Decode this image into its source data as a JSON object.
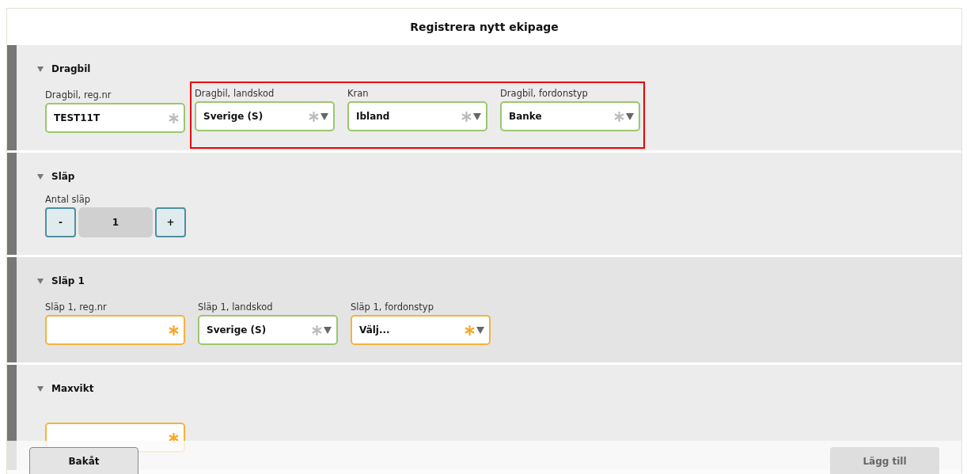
{
  "window": {
    "title": "Registrera nytt ekipage"
  },
  "sections": [
    {
      "title": "Dragbil",
      "expanded": true,
      "active": false,
      "kind": "fields",
      "groups": [
        {
          "highlighted": false,
          "fields": [
            {
              "label": "Dragbil, reg.nr",
              "kind": "text",
              "value": "TEST11T",
              "valid": true
            }
          ]
        },
        {
          "highlighted": true,
          "fields": [
            {
              "label": "Dragbil, landskod",
              "kind": "select",
              "value": "Sverige (S)",
              "valid": true
            },
            {
              "label": "Kran",
              "kind": "select",
              "value": "Ibland",
              "valid": true
            },
            {
              "label": "Dragbil, fordonstyp",
              "kind": "select",
              "value": "Banke",
              "valid": true
            }
          ]
        }
      ]
    },
    {
      "title": "Släp",
      "expanded": true,
      "active": false,
      "kind": "stepper",
      "stepper": {
        "label": "Antal släp",
        "minus": "-",
        "value": "1",
        "plus": "+"
      }
    },
    {
      "title": "Släp 1",
      "expanded": true,
      "active": true,
      "kind": "fields",
      "groups": [
        {
          "highlighted": false,
          "fields": [
            {
              "label": "Släp 1, reg.nr",
              "kind": "text",
              "valid": false
            },
            {
              "label": "Släp 1, landskod",
              "kind": "select",
              "value": "Sverige (S)",
              "valid": true
            },
            {
              "label": "Släp 1, fordonstyp",
              "kind": "select",
              "value": "Välj...",
              "valid": false
            }
          ]
        }
      ]
    },
    {
      "title": "Maxvikt",
      "expanded": true,
      "active": false,
      "kind": "fields",
      "groups": [
        {
          "highlighted": false,
          "fields": [
            {
              "kind": "text",
              "valid": false
            }
          ]
        }
      ]
    }
  ],
  "footer": {
    "back": {
      "label": "Bakåt",
      "disabled": false
    },
    "add": {
      "label": "Lägg till",
      "disabled": true
    }
  }
}
